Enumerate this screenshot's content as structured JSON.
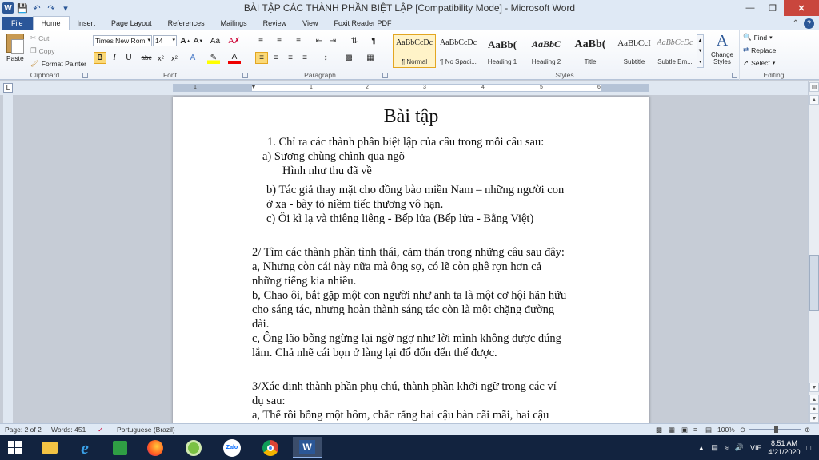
{
  "window": {
    "title": "BÀI TẬP CÁC THÀNH PHẦN BIỆT LẬP [Compatibility Mode] - Microsoft Word",
    "logo_letter": "W"
  },
  "tabs": [
    "File",
    "Home",
    "Insert",
    "Page Layout",
    "References",
    "Mailings",
    "Review",
    "View",
    "Foxit Reader PDF"
  ],
  "ribbon": {
    "clipboard": {
      "label": "Clipboard",
      "paste": "Paste",
      "cut": "Cut",
      "copy": "Copy",
      "format_painter": "Format Painter"
    },
    "font": {
      "label": "Font",
      "family": "Times New Rom",
      "size": "14"
    },
    "paragraph": {
      "label": "Paragraph"
    },
    "styles": {
      "label": "Styles",
      "items": [
        {
          "sample": "AaBbCcDc",
          "name": "¶ Normal"
        },
        {
          "sample": "AaBbCcDc",
          "name": "¶ No Spaci..."
        },
        {
          "sample": "AaBb(",
          "name": "Heading 1"
        },
        {
          "sample": "AaBbC",
          "name": "Heading 2"
        },
        {
          "sample": "AaBb(",
          "name": "Title"
        },
        {
          "sample": "AaBbCcI",
          "name": "Subtitle"
        },
        {
          "sample": "AaBbCcDc",
          "name": "Subtle Em..."
        }
      ],
      "change_styles": "Change Styles"
    },
    "editing": {
      "label": "Editing",
      "find": "Find",
      "replace": "Replace",
      "select": "Select"
    }
  },
  "ruler": {
    "ticks": [
      "1",
      "1",
      "2",
      "3",
      "4",
      "5",
      "6"
    ]
  },
  "document": {
    "title": "Bài tập",
    "lines": [
      "1.  Chỉ ra các thành phần biệt lập của câu trong mỗi câu sau:",
      "a) Sương chùng chình qua ngõ",
      "Hình như thu đã về",
      "b) Tác giả thay mặt cho đồng bào miền Nam – những người con",
      "ở xa - bày tỏ niềm tiếc thương vô hạn.",
      "c) Ôi kì lạ và thiêng liêng - Bếp lửa (Bếp lửa - Bằng Việt)",
      "2/  Tìm các thành phần tình thái, cảm thán trong những câu sau đây:",
      "a, Nhưng còn cái này nữa mà ông sợ, có lẽ còn ghê rợn hơn cả",
      "những tiếng kia nhiều.",
      "b, Chao ôi, bắt gặp một con người như anh ta là một cơ hội hãn hữu",
      "cho sáng tác, nhưng hoàn thành sáng tác còn là một chặng đường",
      "dài.",
      "c, Ông lão bỗng ngừng lại ngờ ngợ như lời mình không được đúng",
      "lắm. Chả nhẽ cái bọn ở làng lại đổ đốn đến thế được.",
      "3/Xác định thành phần phụ chú, thành phần khởi ngữ trong các ví",
      "dụ sau:",
      "a, Thế rồi bỗng một hôm, chắc rằng hai cậu bàn cãi mãi, hai cậu"
    ]
  },
  "status": {
    "page": "Page: 2 of 2",
    "words": "Words: 451",
    "language": "Portuguese (Brazil)",
    "zoom": "100%"
  },
  "taskbar": {
    "apps": [
      "file-explorer",
      "internet-explorer",
      "store",
      "firefox",
      "coccoc",
      "zalo",
      "chrome",
      "word"
    ],
    "zalo_label": "Zalo",
    "language": "VIE",
    "time": "8:51 AM",
    "date": "4/21/2020"
  }
}
